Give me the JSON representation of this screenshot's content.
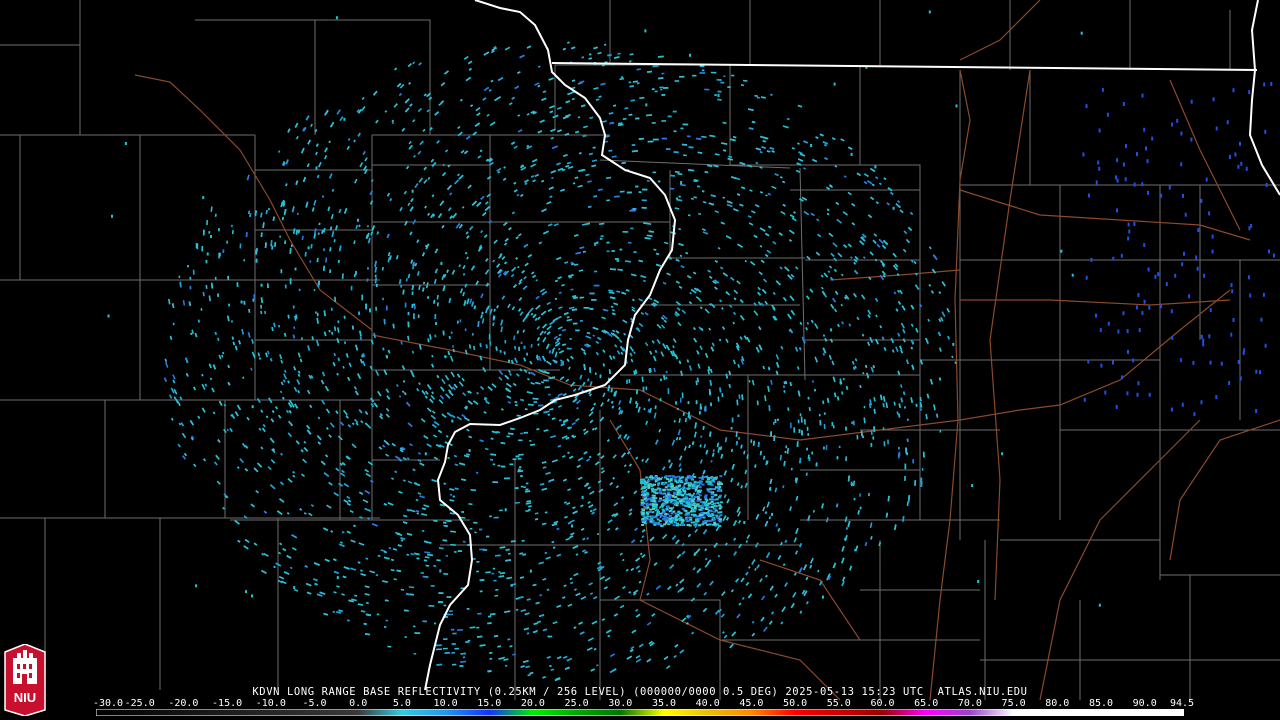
{
  "product": {
    "caption": "KDVN LONG RANGE BASE REFLECTIVITY (0.25KM / 256 LEVEL) (000000/0000 0.5 DEG) 2025-05-13 15:23 UTC  ATLAS.NIU.EDU",
    "logo_text": "NIU"
  },
  "color_scale": {
    "tick_labels": [
      "-30.0",
      "-25.0",
      "-20.0",
      "-15.0",
      "-10.0",
      "-5.0",
      "0.0",
      "5.0",
      "10.0",
      "15.0",
      "20.0",
      "25.0",
      "30.0",
      "35.0",
      "40.0",
      "45.0",
      "50.0",
      "55.0",
      "60.0",
      "65.0",
      "70.0",
      "75.0",
      "80.0",
      "85.0",
      "90.0",
      "94.5"
    ],
    "stops": [
      {
        "dbz": -30,
        "color": "#000000"
      },
      {
        "dbz": 0,
        "color": "#3a3a3a"
      },
      {
        "dbz": 5,
        "color": "#33ccdd"
      },
      {
        "dbz": 10,
        "color": "#2299ee"
      },
      {
        "dbz": 15,
        "color": "#1133ff"
      },
      {
        "dbz": 20,
        "color": "#00ee00"
      },
      {
        "dbz": 25,
        "color": "#00aa00"
      },
      {
        "dbz": 30,
        "color": "#007700"
      },
      {
        "dbz": 35,
        "color": "#ffff00"
      },
      {
        "dbz": 40,
        "color": "#e8c000"
      },
      {
        "dbz": 45,
        "color": "#ff8800"
      },
      {
        "dbz": 50,
        "color": "#ff0000"
      },
      {
        "dbz": 55,
        "color": "#cc0000"
      },
      {
        "dbz": 60,
        "color": "#990000"
      },
      {
        "dbz": 65,
        "color": "#ff00ff"
      },
      {
        "dbz": 70,
        "color": "#9944cc"
      },
      {
        "dbz": 75,
        "color": "#ffffff"
      },
      {
        "dbz": 94.5,
        "color": "#ffffff"
      }
    ]
  },
  "map_style": {
    "background": "#000000",
    "county_color": "#6e6e6e",
    "state_color": "#ffffff",
    "highway_color": "#8b4a2a",
    "echo_colors": [
      "#22c3d4",
      "#3bbad8",
      "#1fa3d6",
      "#2a79e0",
      "#58d0c0",
      "#1c50e6"
    ]
  }
}
